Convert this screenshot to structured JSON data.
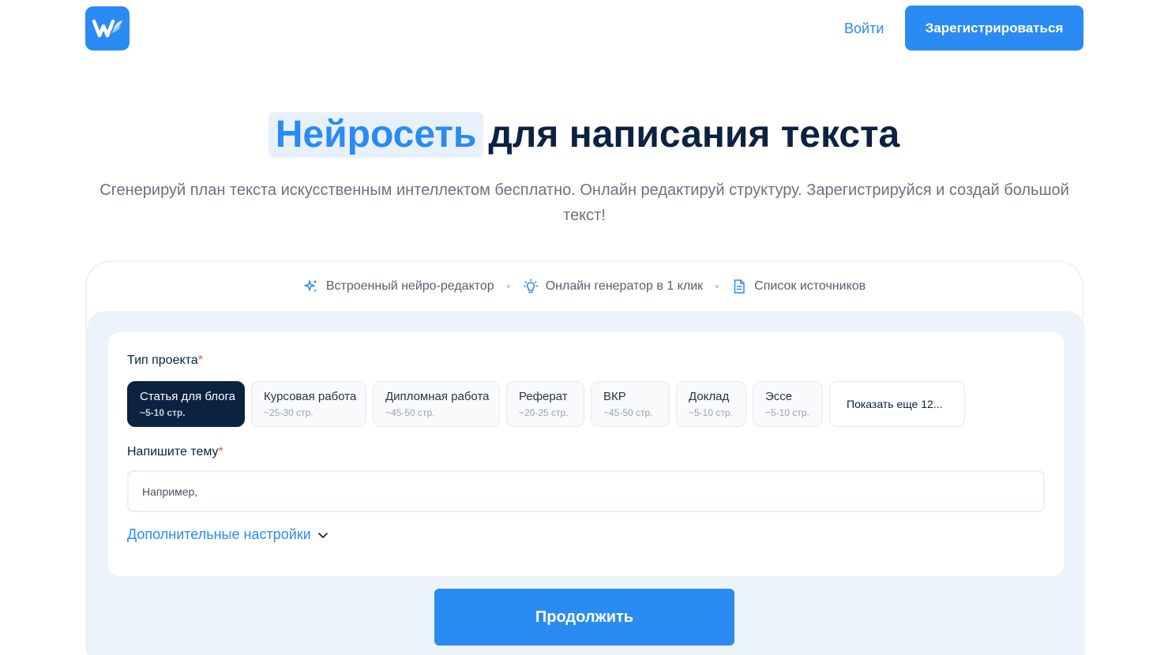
{
  "header": {
    "login_label": "Войти",
    "signup_label": "Зарегистрироваться"
  },
  "hero": {
    "title_highlight": "Нейросеть",
    "title_rest": "для написания текста",
    "subtitle": "Сгенерируй план текста искусственным интеллектом бесплатно. Онлайн редактируй структуру. Зарегистрируйся и создай большой текст!"
  },
  "features": [
    {
      "label": "Встроенный нейро-редактор",
      "icon": "sparkles-icon"
    },
    {
      "label": "Онлайн генератор в 1 клик",
      "icon": "lightbulb-icon"
    },
    {
      "label": "Список источников",
      "icon": "document-icon"
    }
  ],
  "form": {
    "project_type_label": "Тип проекта",
    "required_mark": "*",
    "project_types": [
      {
        "title": "Статья для блога",
        "pages": "~5-10 стр.",
        "selected": true
      },
      {
        "title": "Курсовая работа",
        "pages": "~25-30 стр.",
        "selected": false
      },
      {
        "title": "Дипломная работа",
        "pages": "~45-50 стр.",
        "selected": false
      },
      {
        "title": "Реферат",
        "pages": "~20-25 стр.",
        "selected": false
      },
      {
        "title": "ВКР",
        "pages": "~45-50 стр.",
        "selected": false
      },
      {
        "title": "Доклад",
        "pages": "~5-10 стр.",
        "selected": false
      },
      {
        "title": "Эссе",
        "pages": "~5-10 стр.",
        "selected": false
      }
    ],
    "show_more_label": "Показать еще 12...",
    "topic_label": "Напишите тему",
    "topic_placeholder": "Например,",
    "topic_value": "",
    "advanced_label": "Дополнительные настройки",
    "continue_label": "Продолжить"
  },
  "colors": {
    "accent": "#2a8bf2",
    "dark": "#0b2240",
    "panel": "#edf3fa"
  }
}
